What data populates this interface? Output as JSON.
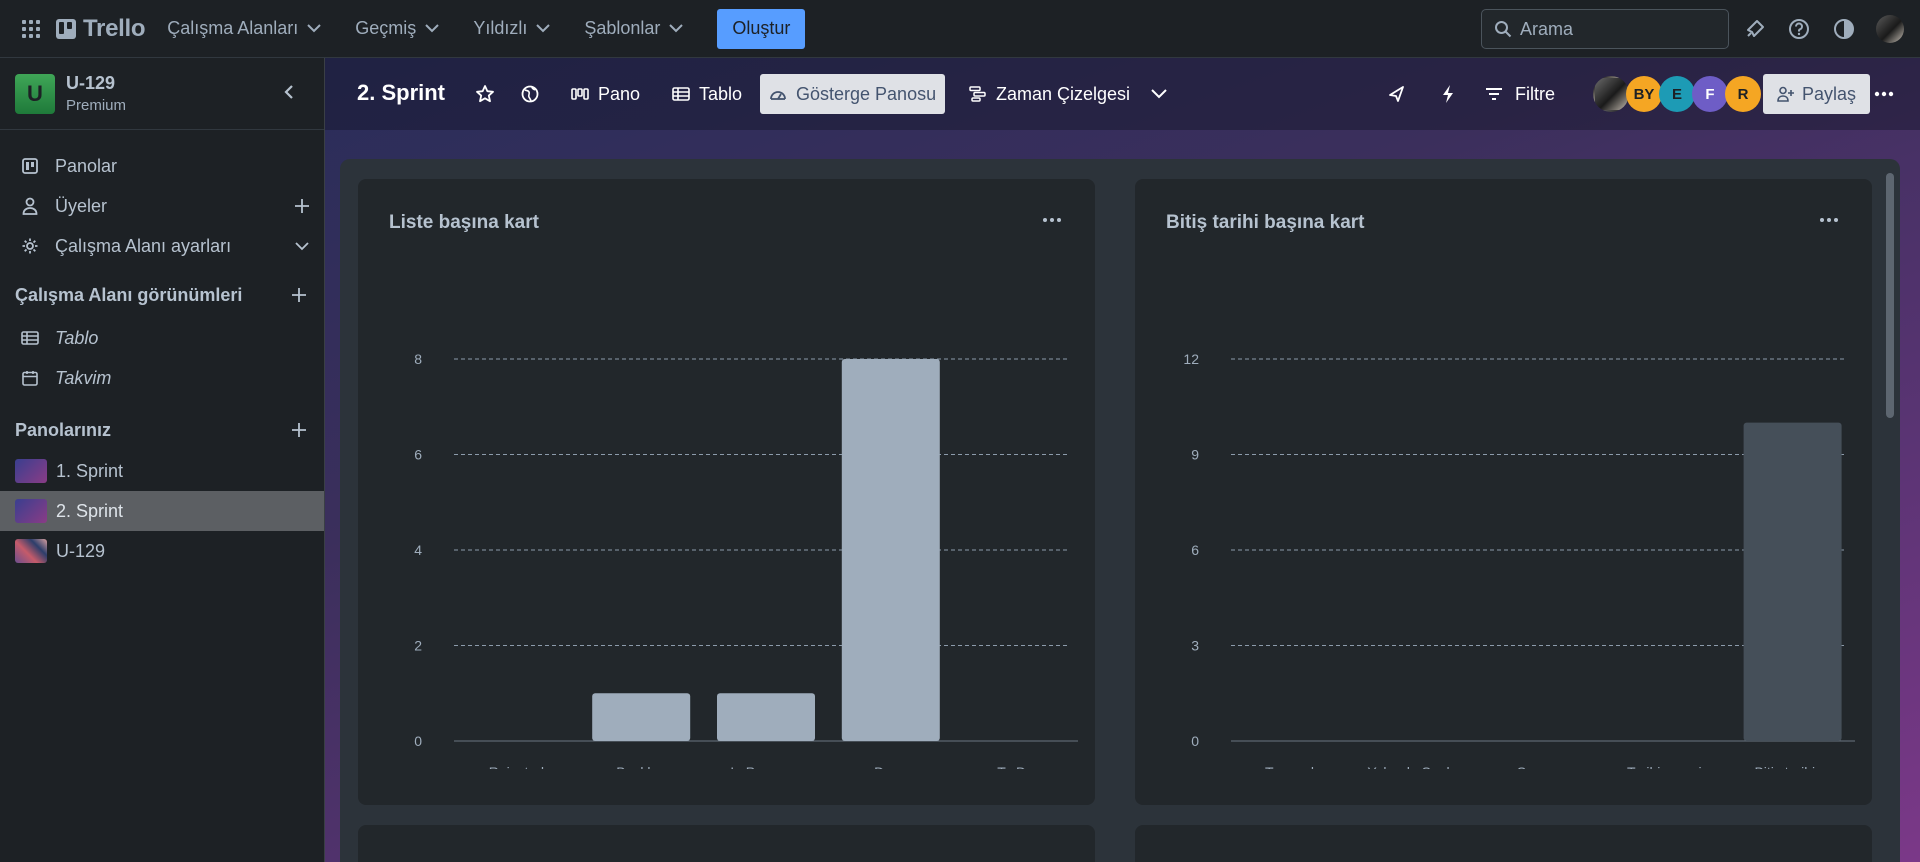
{
  "topbar": {
    "brand": "Trello",
    "nav": [
      {
        "label": "Çalışma Alanları"
      },
      {
        "label": "Geçmiş"
      },
      {
        "label": "Yıldızlı"
      },
      {
        "label": "Şablonlar"
      }
    ],
    "create_label": "Oluştur",
    "search_placeholder": "Arama"
  },
  "sidebar": {
    "workspace_initial": "U",
    "workspace_name": "U-129",
    "workspace_plan": "Premium",
    "items": [
      {
        "label": "Panolar"
      },
      {
        "label": "Üyeler"
      },
      {
        "label": "Çalışma Alanı ayarları"
      }
    ],
    "views_title": "Çalışma Alanı görünümleri",
    "views": [
      {
        "label": "Tablo"
      },
      {
        "label": "Takvim"
      }
    ],
    "boards_title": "Panolarınız",
    "boards": [
      {
        "label": "1. Sprint",
        "active": false
      },
      {
        "label": "2. Sprint",
        "active": true
      },
      {
        "label": "U-129",
        "active": false
      }
    ]
  },
  "board": {
    "title": "2. Sprint",
    "views": [
      {
        "label": "Pano"
      },
      {
        "label": "Tablo"
      },
      {
        "label": "Gösterge Panosu",
        "active": true
      },
      {
        "label": "Zaman Çizelgesi"
      }
    ],
    "filter_label": "Filtre",
    "members": [
      {
        "initials": "",
        "color": "#3a3a3a"
      },
      {
        "initials": "BY",
        "color": "#f5a623"
      },
      {
        "initials": "E",
        "color": "#1d9bb5"
      },
      {
        "initials": "F",
        "color": "#6e5dc6"
      },
      {
        "initials": "R",
        "color": "#f5a623"
      }
    ],
    "share_label": "Paylaş"
  },
  "cards": [
    {
      "title": "Liste başına kart"
    },
    {
      "title": "Bitiş tarihi başına kart"
    }
  ],
  "chart_data": [
    {
      "type": "bar",
      "title": "Liste başına kart",
      "categories": [
        "Rejected",
        "Backlog",
        "In Progress",
        "Done",
        "To Do"
      ],
      "values": [
        0,
        1,
        1,
        8,
        0
      ],
      "yticks": [
        0,
        2,
        4,
        6,
        8
      ],
      "ylim": [
        0,
        8
      ],
      "bar_color": "#9fadbc",
      "grid": true
    },
    {
      "type": "bar",
      "title": "Bitiş tarihi başına kart",
      "categories": [
        "Tamamla",
        "Yakında Sonla...",
        "Sonraya",
        "Tarihi geçmiş",
        "Bitiş tarihi ..."
      ],
      "values": [
        0,
        0,
        0,
        0,
        10
      ],
      "yticks": [
        0,
        3,
        6,
        9,
        12
      ],
      "ylim": [
        0,
        12
      ],
      "bar_color": "#454f59",
      "grid": true
    }
  ]
}
